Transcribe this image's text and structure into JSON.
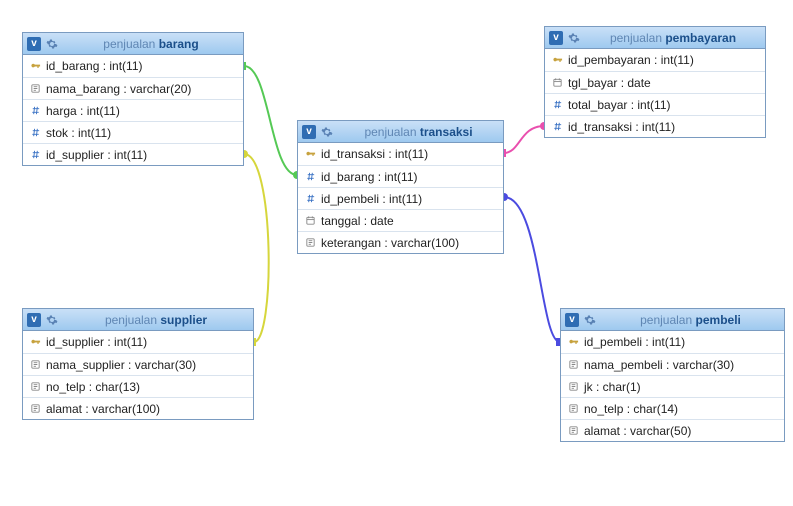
{
  "schema": "penjualan",
  "tables": {
    "barang": {
      "name": "barang",
      "columns": [
        {
          "icon": "key",
          "label": "id_barang : int(11)"
        },
        {
          "icon": "text",
          "label": "nama_barang : varchar(20)"
        },
        {
          "icon": "num",
          "label": "harga : int(11)"
        },
        {
          "icon": "num",
          "label": "stok : int(11)"
        },
        {
          "icon": "num",
          "label": "id_supplier : int(11)"
        }
      ]
    },
    "transaksi": {
      "name": "transaksi",
      "columns": [
        {
          "icon": "key",
          "label": "id_transaksi : int(11)"
        },
        {
          "icon": "num",
          "label": "id_barang : int(11)"
        },
        {
          "icon": "num",
          "label": "id_pembeli : int(11)"
        },
        {
          "icon": "date",
          "label": "tanggal : date"
        },
        {
          "icon": "text",
          "label": "keterangan : varchar(100)"
        }
      ]
    },
    "pembayaran": {
      "name": "pembayaran",
      "columns": [
        {
          "icon": "key",
          "label": "id_pembayaran : int(11)"
        },
        {
          "icon": "date",
          "label": "tgl_bayar : date"
        },
        {
          "icon": "num",
          "label": "total_bayar : int(11)"
        },
        {
          "icon": "num",
          "label": "id_transaksi : int(11)"
        }
      ]
    },
    "supplier": {
      "name": "supplier",
      "columns": [
        {
          "icon": "key",
          "label": "id_supplier : int(11)"
        },
        {
          "icon": "text",
          "label": "nama_supplier : varchar(30)"
        },
        {
          "icon": "text",
          "label": "no_telp : char(13)"
        },
        {
          "icon": "text",
          "label": "alamat : varchar(100)"
        }
      ]
    },
    "pembeli": {
      "name": "pembeli",
      "columns": [
        {
          "icon": "key",
          "label": "id_pembeli : int(11)"
        },
        {
          "icon": "text",
          "label": "nama_pembeli : varchar(30)"
        },
        {
          "icon": "text",
          "label": "jk : char(1)"
        },
        {
          "icon": "text",
          "label": "no_telp : char(14)"
        },
        {
          "icon": "text",
          "label": "alamat : varchar(50)"
        }
      ]
    }
  },
  "relations": [
    {
      "from": "transaksi.id_barang",
      "to": "barang.id_barang",
      "color": "#55c955"
    },
    {
      "from": "barang.id_supplier",
      "to": "supplier.id_supplier",
      "color": "#d6d63c"
    },
    {
      "from": "pembayaran.id_transaksi",
      "to": "transaksi.id_transaksi",
      "color": "#e94fae"
    },
    {
      "from": "transaksi.id_pembeli",
      "to": "pembeli.id_pembeli",
      "color": "#4b4be0"
    }
  ],
  "chart_data": {
    "type": "table",
    "description": "phpMyAdmin Designer relational diagram for schema 'penjualan' with 5 tables and 4 FK relations",
    "tables": [
      {
        "name": "barang",
        "columns": [
          "id_barang int(11) PK",
          "nama_barang varchar(20)",
          "harga int(11)",
          "stok int(11)",
          "id_supplier int(11) FK→supplier.id_supplier"
        ]
      },
      {
        "name": "transaksi",
        "columns": [
          "id_transaksi int(11) PK",
          "id_barang int(11) FK→barang.id_barang",
          "id_pembeli int(11) FK→pembeli.id_pembeli",
          "tanggal date",
          "keterangan varchar(100)"
        ]
      },
      {
        "name": "pembayaran",
        "columns": [
          "id_pembayaran int(11) PK",
          "tgl_bayar date",
          "total_bayar int(11)",
          "id_transaksi int(11) FK→transaksi.id_transaksi"
        ]
      },
      {
        "name": "supplier",
        "columns": [
          "id_supplier int(11) PK",
          "nama_supplier varchar(30)",
          "no_telp char(13)",
          "alamat varchar(100)"
        ]
      },
      {
        "name": "pembeli",
        "columns": [
          "id_pembeli int(11) PK",
          "nama_pembeli varchar(30)",
          "jk char(1)",
          "no_telp char(14)",
          "alamat varchar(50)"
        ]
      }
    ],
    "foreign_keys": [
      {
        "child": "transaksi.id_barang",
        "parent": "barang.id_barang"
      },
      {
        "child": "barang.id_supplier",
        "parent": "supplier.id_supplier"
      },
      {
        "child": "pembayaran.id_transaksi",
        "parent": "transaksi.id_transaksi"
      },
      {
        "child": "transaksi.id_pembeli",
        "parent": "pembeli.id_pembeli"
      }
    ]
  }
}
